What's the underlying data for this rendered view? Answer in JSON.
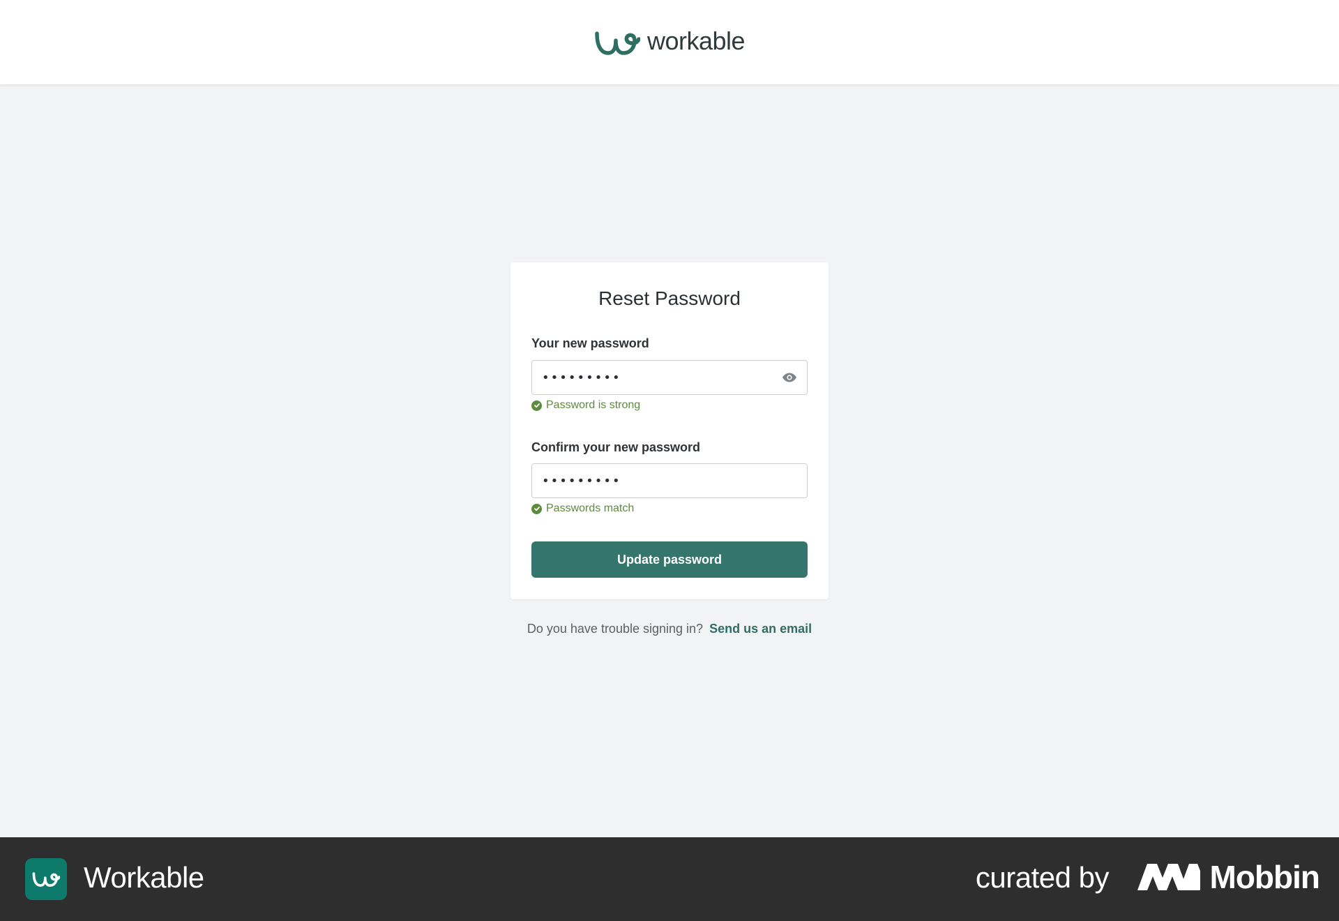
{
  "header": {
    "brand_name": "workable"
  },
  "card": {
    "title": "Reset Password",
    "new_password": {
      "label": "Your new password",
      "value": "•••••••••",
      "status": "Password is strong"
    },
    "confirm_password": {
      "label": "Confirm your new password",
      "value": "•••••••••",
      "status": "Passwords match"
    },
    "submit_label": "Update password"
  },
  "help": {
    "question": "Do you have trouble signing in?",
    "link_text": "Send us an email"
  },
  "footer": {
    "app_name": "Workable",
    "curated_by": "curated by",
    "curator": "Mobbin"
  },
  "colors": {
    "brand_green": "#34766b",
    "success_green": "#5d8a3e",
    "footer_bg": "#2e2e2e"
  },
  "icons": {
    "brand": "workable-logo-icon",
    "reveal": "eye-icon",
    "status": "check-circle-icon"
  }
}
